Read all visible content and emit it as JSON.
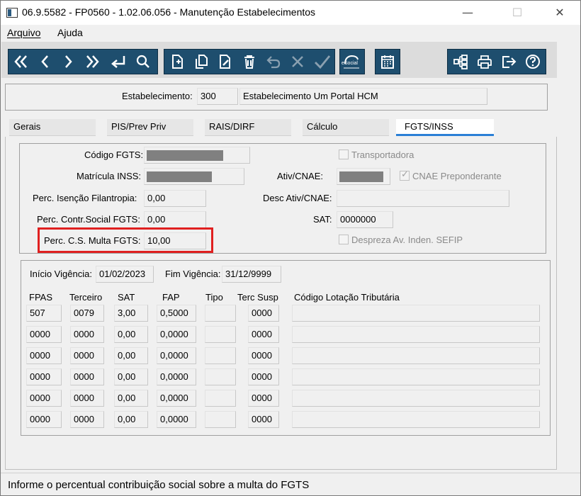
{
  "window": {
    "title": "06.9.5582 - FP0560 - 1.02.06.056 - Manutenção Estabelecimentos",
    "minimize": "—",
    "maximize": "☐",
    "close": "✕"
  },
  "menu": {
    "file": "Arquivo",
    "help": "Ajuda"
  },
  "toolbar": {
    "icons": [
      "first-icon",
      "previous-icon",
      "next-icon",
      "last-icon",
      "goto-icon",
      "search-icon",
      "new-icon",
      "copy-icon",
      "edit-icon",
      "delete-icon",
      "undo-icon",
      "cancel-icon",
      "save-icon",
      "esocial-icon",
      "calendar-icon",
      "tree-icon",
      "print-icon",
      "exit-icon",
      "help-icon"
    ],
    "esocial_label": "eSocial"
  },
  "establishment": {
    "label": "Estabelecimento:",
    "code": "300",
    "name": "Estabelecimento Um Portal HCM"
  },
  "tabs": [
    {
      "label": "Gerais"
    },
    {
      "label": "PIS/Prev Priv"
    },
    {
      "label": "RAIS/DIRF"
    },
    {
      "label": "Cálculo"
    },
    {
      "label": "FGTS/INSS"
    }
  ],
  "form": {
    "codigo_fgts_label": "Código FGTS:",
    "matricula_inss_label": "Matrícula INSS:",
    "perc_isencao_label": "Perc. Isenção Filantropia:",
    "perc_isencao_value": "0,00",
    "perc_contr_label": "Perc. Contr.Social FGTS:",
    "perc_contr_value": "0,00",
    "perc_multa_label": "Perc. C.S. Multa FGTS:",
    "perc_multa_value": "10,00",
    "transportadora_label": "Transportadora",
    "ativ_cnae_label": "Ativ/CNAE:",
    "cnae_preponderante_label": "CNAE Preponderante",
    "desc_ativ_label": "Desc Ativ/CNAE:",
    "sat_label": "SAT:",
    "sat_value": "0000000",
    "despreza_label": "Despreza Av. Inden. SEFIP"
  },
  "vigencia": {
    "inicio_label": "Início Vigência:",
    "inicio_value": "01/02/2023",
    "fim_label": "Fim Vigência:",
    "fim_value": "31/12/9999"
  },
  "grid": {
    "headers": {
      "fpas": "FPAS",
      "terceiro": "Terceiro",
      "sat": "SAT",
      "fap": "FAP",
      "tipo": "Tipo",
      "terc_susp": "Terc Susp",
      "codigo_lotacao": "Código Lotação Tributária"
    },
    "rows": [
      {
        "fpas": "507",
        "terceiro": "0079",
        "sat": "3,00",
        "fap": "0,5000",
        "tipo": "",
        "terc_susp": "0000",
        "codigo_lotacao": ""
      },
      {
        "fpas": "0000",
        "terceiro": "0000",
        "sat": "0,00",
        "fap": "0,0000",
        "tipo": "",
        "terc_susp": "0000",
        "codigo_lotacao": ""
      },
      {
        "fpas": "0000",
        "terceiro": "0000",
        "sat": "0,00",
        "fap": "0,0000",
        "tipo": "",
        "terc_susp": "0000",
        "codigo_lotacao": ""
      },
      {
        "fpas": "0000",
        "terceiro": "0000",
        "sat": "0,00",
        "fap": "0,0000",
        "tipo": "",
        "terc_susp": "0000",
        "codigo_lotacao": ""
      },
      {
        "fpas": "0000",
        "terceiro": "0000",
        "sat": "0,00",
        "fap": "0,0000",
        "tipo": "",
        "terc_susp": "0000",
        "codigo_lotacao": ""
      },
      {
        "fpas": "0000",
        "terceiro": "0000",
        "sat": "0,00",
        "fap": "0,0000",
        "tipo": "",
        "terc_susp": "0000",
        "codigo_lotacao": ""
      }
    ]
  },
  "status": {
    "message": "Informe o percentual contribuição social sobre a multa do FGTS"
  },
  "colors": {
    "toolbar_bg": "#1e4e6e",
    "active_tab_underline": "#2b7fd6",
    "highlight": "#e02020"
  }
}
